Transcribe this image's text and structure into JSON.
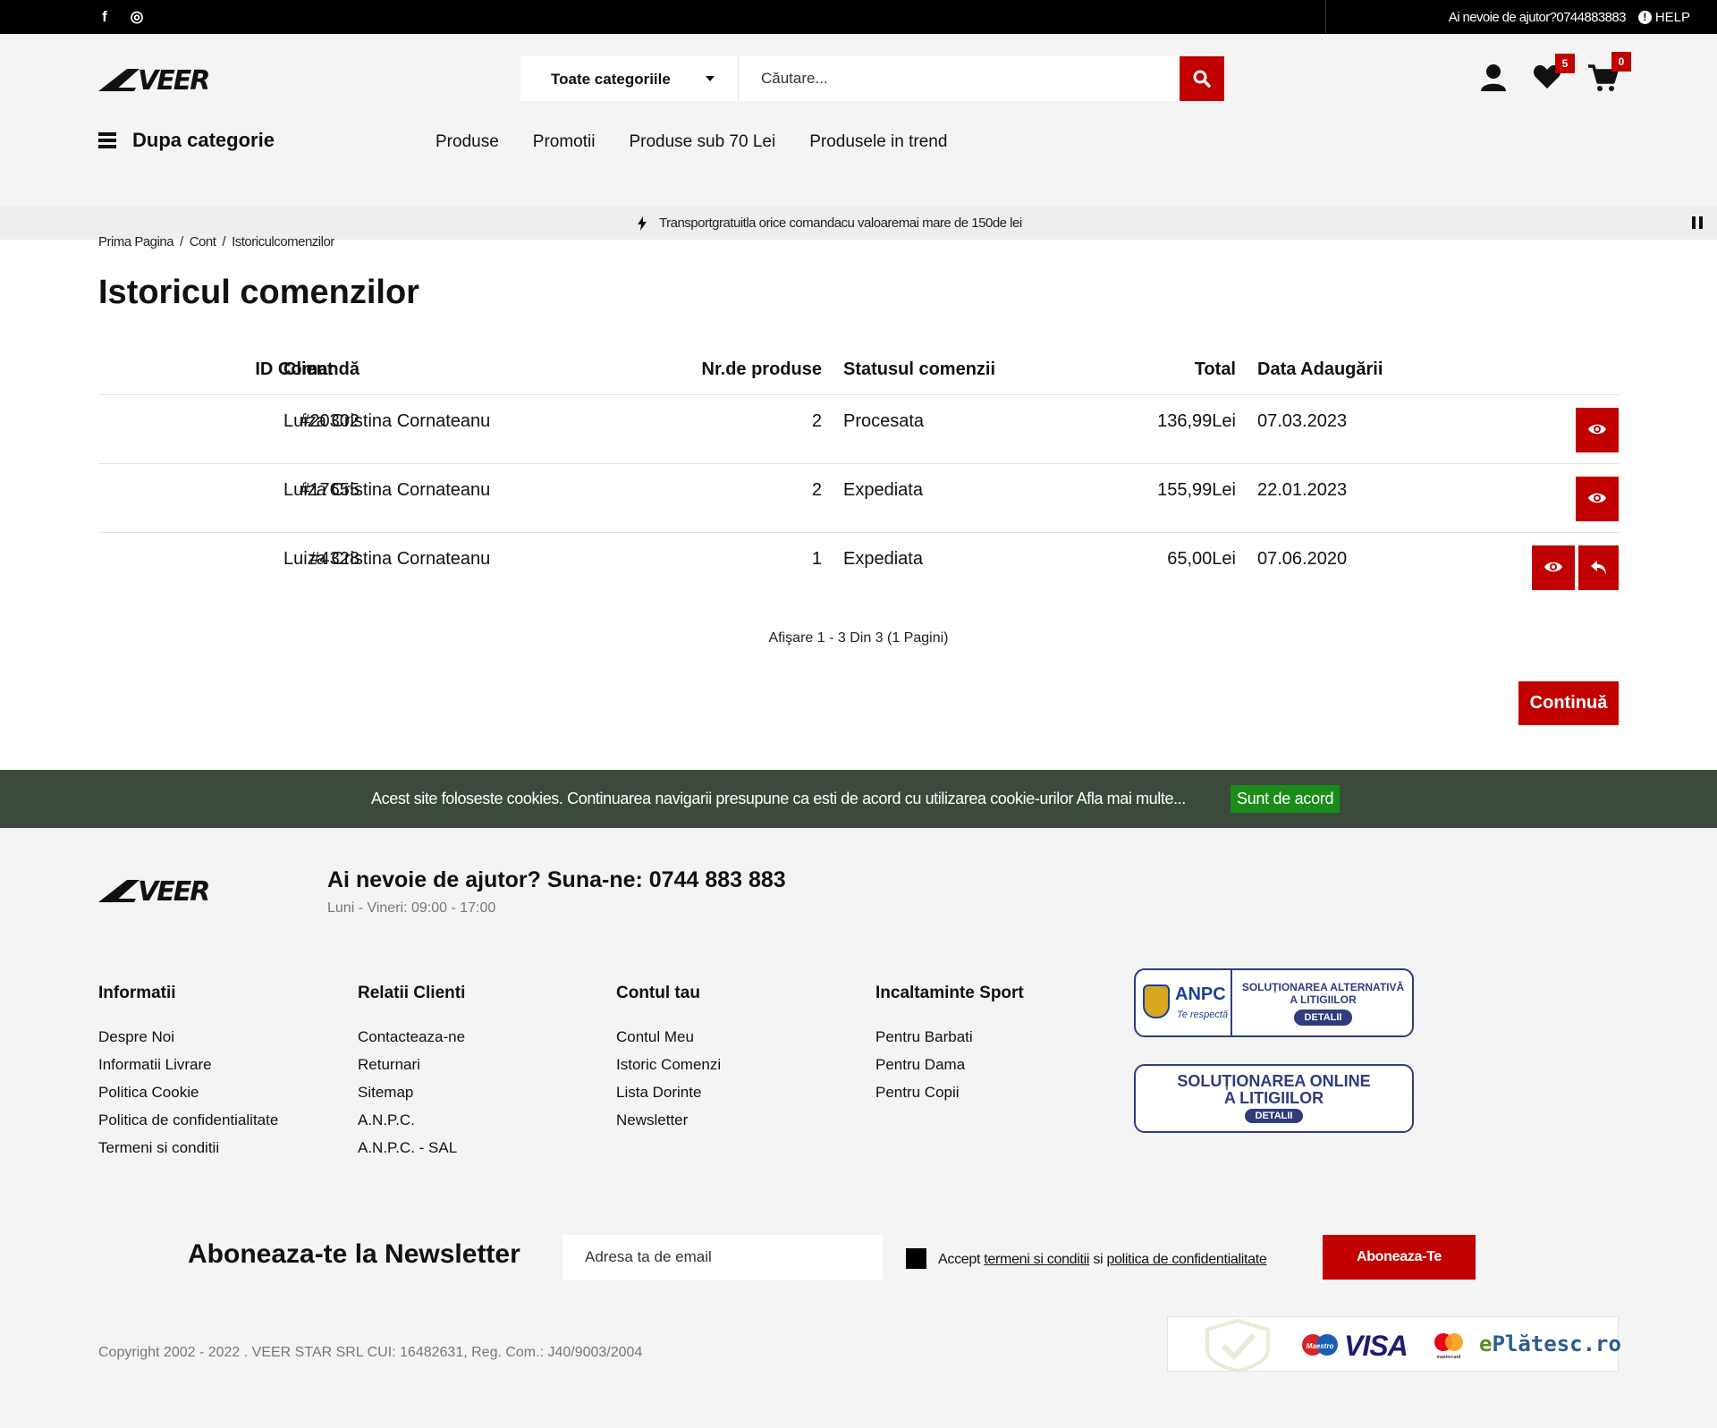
{
  "topbar": {
    "social": [
      {
        "name": "facebook",
        "glyph": "f"
      },
      {
        "name": "instagram",
        "glyph": "◎"
      }
    ],
    "help_text": "Ai nevoie de ajutor?0744883883",
    "help_label": "HELP",
    "help_icon": "!"
  },
  "header": {
    "logo_text": "VEER",
    "search": {
      "category_label": "Toate categoriile",
      "placeholder": "Căutare..."
    },
    "wishlist_count": "5",
    "cart_count": "0"
  },
  "nav": {
    "category_button": "Dupa categorie",
    "items": [
      "Produse",
      "Promotii",
      "Produse sub 70 Lei",
      "Produsele in trend"
    ]
  },
  "promo_banner": "Transportgratuitla orice comandacu valoaremai mare de 150de lei",
  "breadcrumb": [
    "Prima Pagina",
    "Cont",
    "Istoriculcomenzilor"
  ],
  "breadcrumb_sep": "/",
  "page_title": "Istoricul comenzilor",
  "table": {
    "headers": {
      "id": "ID Comandă",
      "client": "Client",
      "qty": "Nr.de produse",
      "status": "Statusul comenzii",
      "total": "Total",
      "date": "Data Adaugării"
    },
    "rows": [
      {
        "id": "#20302",
        "client": "Luiza Cristina Cornateanu",
        "qty": "2",
        "status": "Procesata",
        "total": "136,99Lei",
        "date": "07.03.2023"
      },
      {
        "id": "#17655",
        "client": "Luiza Cristina Cornateanu",
        "qty": "2",
        "status": "Expediata",
        "total": "155,99Lei",
        "date": "22.01.2023"
      },
      {
        "id": "#4328",
        "client": "Luiza Cristina Cornateanu",
        "qty": "1",
        "status": "Expediata",
        "total": "65,00Lei",
        "date": "07.06.2020"
      }
    ]
  },
  "pagination_info": "Afişare 1 - 3 Din 3 (1 Pagini)",
  "continue_label": "Continuă",
  "cookie": {
    "message": "Acest site foloseste cookies. Continuarea navigarii presupune ca esti de acord cu utilizarea cookie-urilor Afla mai multe...",
    "agree_label": "Sunt de acord"
  },
  "footer": {
    "helpline": "Ai nevoie de ajutor? Suna-ne: 0744 883 883",
    "hours": "Luni - Vineri: 09:00 - 17:00",
    "columns": [
      {
        "title": "Informatii",
        "links": [
          "Despre Noi",
          "Informatii Livrare",
          "Politica Cookie",
          "Politica de confidentialitate",
          "Termeni si conditii"
        ]
      },
      {
        "title": "Relatii Clienti",
        "links": [
          "Contacteaza-ne",
          "Returnari",
          "Sitemap",
          "A.N.P.C.",
          "A.N.P.C. - SAL"
        ]
      },
      {
        "title": "Contul tau",
        "links": [
          "Contul Meu",
          "Istoric Comenzi",
          "Lista Dorinte",
          "Newsletter"
        ]
      },
      {
        "title": "Incaltaminte  Sport",
        "links": [
          "Pentru Barbati",
          "Pentru Dama",
          "Pentru Copii"
        ]
      }
    ],
    "anpc": {
      "title": "ANPC",
      "subtitle": "Te respectă",
      "line1": "SOLUȚIONAREA ALTERNATIVĂ",
      "line2": "A LITIGIILOR",
      "pill": "DETALII"
    },
    "sol": {
      "line1": "SOLUȚIONAREA ONLINE",
      "line2": "A LITIGIILOR",
      "pill": "DETALII"
    },
    "newsletter": {
      "title": "Aboneaza-te la Newsletter",
      "placeholder": "Adresa ta de email",
      "accept_prefix": "Accept",
      "terms_link": "termeni si conditii",
      "and": "si",
      "privacy_link": "politica de confidentialitate",
      "button": "Aboneaza-Te"
    },
    "copyright": "Copyright 2002 - 2022 . VEER STAR SRL CUI: 16482631, Reg. Com.: J40/9003/2004",
    "payments": {
      "maestro": "Maestro",
      "visa": "VISA",
      "mastercard": "mastercard",
      "platesc": "Plătesc.ro",
      "platesc_prefix": "e"
    }
  },
  "colors": {
    "accent": "#c10000",
    "topbar": "#000000",
    "cookie_bar": "#3c4a3e",
    "cookie_agree": "#1a8c1a",
    "badge_blue": "#2f3c7e"
  }
}
